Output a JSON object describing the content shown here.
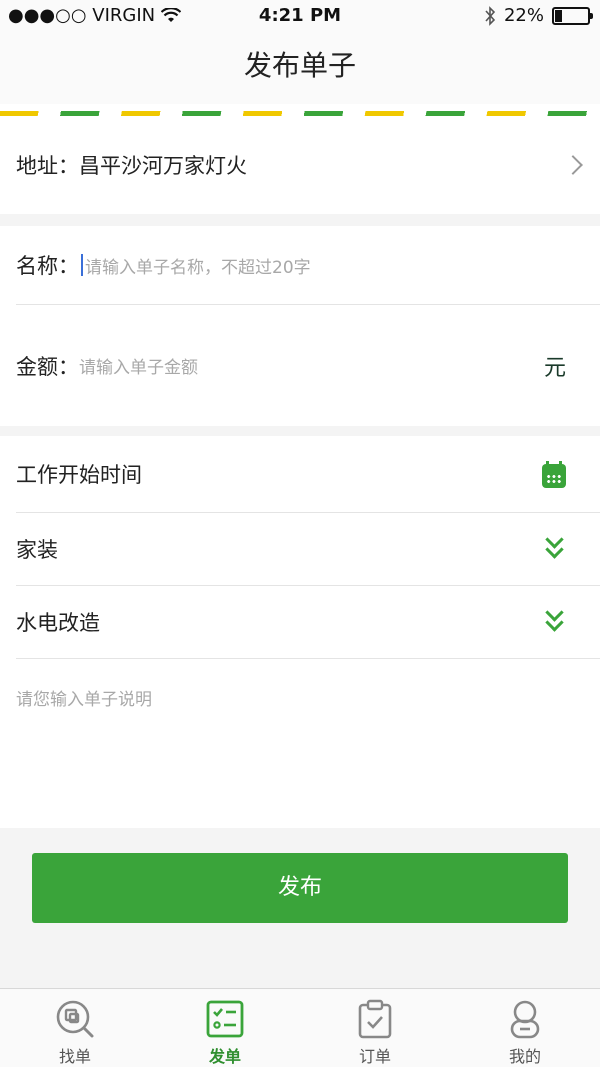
{
  "status": {
    "carrier": "●●●○○ VIRGIN",
    "time": "4:21 PM",
    "battery": "22%",
    "battery_level": 0.22
  },
  "navbar": {
    "title": "发布单子"
  },
  "address": {
    "label": "地址：",
    "value": "昌平沙河万家灯火"
  },
  "name_field": {
    "label": "名称：",
    "placeholder": "请输入单子名称，不超过20字"
  },
  "amount_field": {
    "label": "金额：",
    "placeholder": "请输入单子金额",
    "unit": "元"
  },
  "options": {
    "start_time": "工作开始时间",
    "category": "家装",
    "subcategory": "水电改造"
  },
  "description": {
    "placeholder": "请您输入单子说明"
  },
  "submit_label": "发布",
  "tabs": [
    {
      "label": "找单",
      "icon": "search-order-icon",
      "active": false
    },
    {
      "label": "发单",
      "icon": "post-order-icon",
      "active": true
    },
    {
      "label": "订单",
      "icon": "clipboard-icon",
      "active": false
    },
    {
      "label": "我的",
      "icon": "profile-icon",
      "active": false
    }
  ],
  "colors": {
    "accent": "#3aa43a",
    "stripe_yellow": "#f0c800"
  }
}
